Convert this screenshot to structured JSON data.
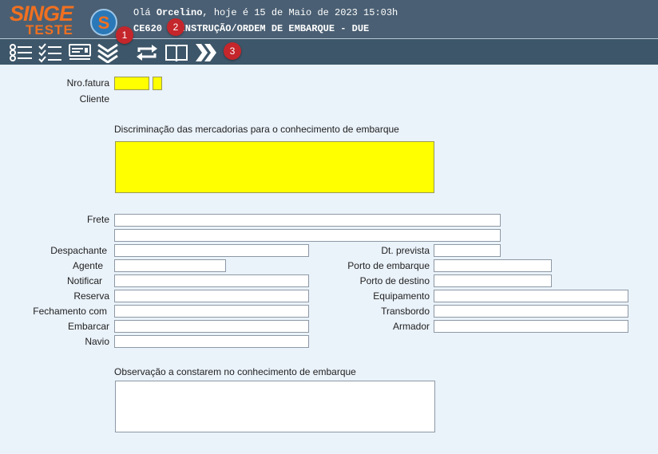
{
  "brand": {
    "name": "SINGE",
    "env": "TESTE",
    "circle_letter": "S"
  },
  "header": {
    "greeting_prefix": "Olá ",
    "user": "Orcelino",
    "greeting_suffix": ", hoje é 15 de Maio de 2023 15:03h",
    "screen_title": "CE620 - INSTRUÇÃO/ORDEM DE EMBARQUE - DUE"
  },
  "toolbar": {
    "buttons": [
      "list-icon",
      "checklist-icon",
      "card-icon",
      "collapse-icon",
      "refresh-icon",
      "book-icon",
      "next-icon"
    ]
  },
  "badges": [
    "1",
    "2",
    "3"
  ],
  "form": {
    "nro_fatura_label": "Nro.fatura",
    "cliente_label": "Cliente",
    "discriminacao_label": "Discriminação das mercadorias para o conhecimento de embarque",
    "frete_label": "Frete",
    "despachante_label": "Despachante",
    "agente_label": "Agente",
    "notificar_label": "Notificar",
    "reserva_label": "Reserva",
    "fechamento_label": "Fechamento com",
    "embarcar_label": "Embarcar",
    "navio_label": "Navio",
    "dt_prevista_label": "Dt. prevista",
    "porto_embarque_label": "Porto de embarque",
    "porto_destino_label": "Porto de destino",
    "equipamento_label": "Equipamento",
    "transbordo_label": "Transbordo",
    "armador_label": "Armador",
    "observacao_label": "Observação a constarem no conhecimento de embarque"
  },
  "colors": {
    "header": "#4a5f73",
    "toolbar": "#3d5669",
    "required": "#ffff00",
    "brand": "#f07020",
    "badge": "#c4262b"
  }
}
